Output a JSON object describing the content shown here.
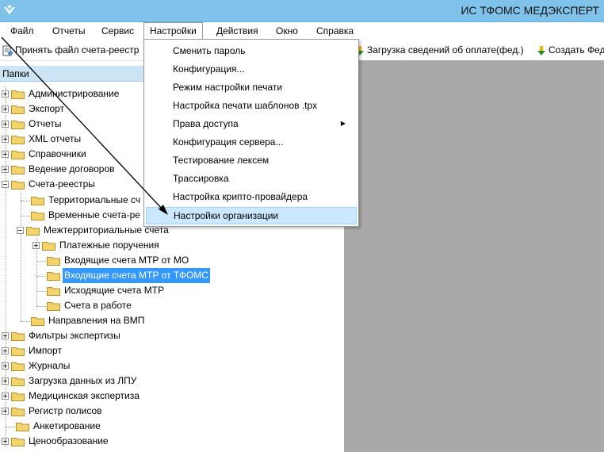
{
  "window": {
    "title": "ИС ТФОМС МЕДЭКСПЕРТ"
  },
  "menubar": {
    "items": [
      "Файл",
      "Отчеты",
      "Сервис",
      "Настройки",
      "Действия",
      "Окно",
      "Справка"
    ]
  },
  "toolbar": {
    "accept_label": "Принять файл счета-реестр",
    "load_label": "Загрузка сведений об оплате(фед.)",
    "create_label": "Создать Фед"
  },
  "panel": {
    "header": "Папки"
  },
  "tree": {
    "nodes": [
      "Администрирование",
      "Экспорт",
      "Отчеты",
      "XML отчеты",
      "Справочники",
      "Ведение договоров",
      "Счета-реестры",
      "Территориальные сч",
      "Временные счета-ре",
      "Межтерриториальные счета",
      "Платежные поручения",
      "Входящие счета МТР от МО",
      "Входящие счета МТР от ТФОМС",
      "Исходящие счета МТР",
      "Счета в работе",
      "Направления на ВМП",
      "Фильтры экспертизы",
      "Импорт",
      "Журналы",
      "Загрузка данных из ЛПУ",
      "Медицинская экспертиза",
      "Регистр полисов",
      "Анкетирование",
      "Ценообразование"
    ]
  },
  "settings_menu": {
    "items": [
      "Сменить пароль",
      "Конфигурация...",
      "Режим настройки печати",
      "Настройка печати шаблонов .tpx",
      "Права доступа",
      "Конфигурация сервера...",
      "Тестирование лексем",
      "Трассировка",
      "Настройка крипто-провайдера",
      "Настройки организации"
    ],
    "highlighted": "Настройки организации"
  },
  "colors": {
    "titlebar": "#7fc3ea",
    "panel_header": "#cde4f5",
    "selection": "#3399ff",
    "menu_highlight": "#cce8ff",
    "content_bg": "#a9a9a9",
    "folder": "#f3d36b"
  },
  "icons": {
    "app": "app-logo-icon",
    "accept": "document-import-icon",
    "load": "download-arrow-icon",
    "create": "create-arrow-icon",
    "folder": "folder-icon",
    "submenu": "chevron-right-icon"
  }
}
